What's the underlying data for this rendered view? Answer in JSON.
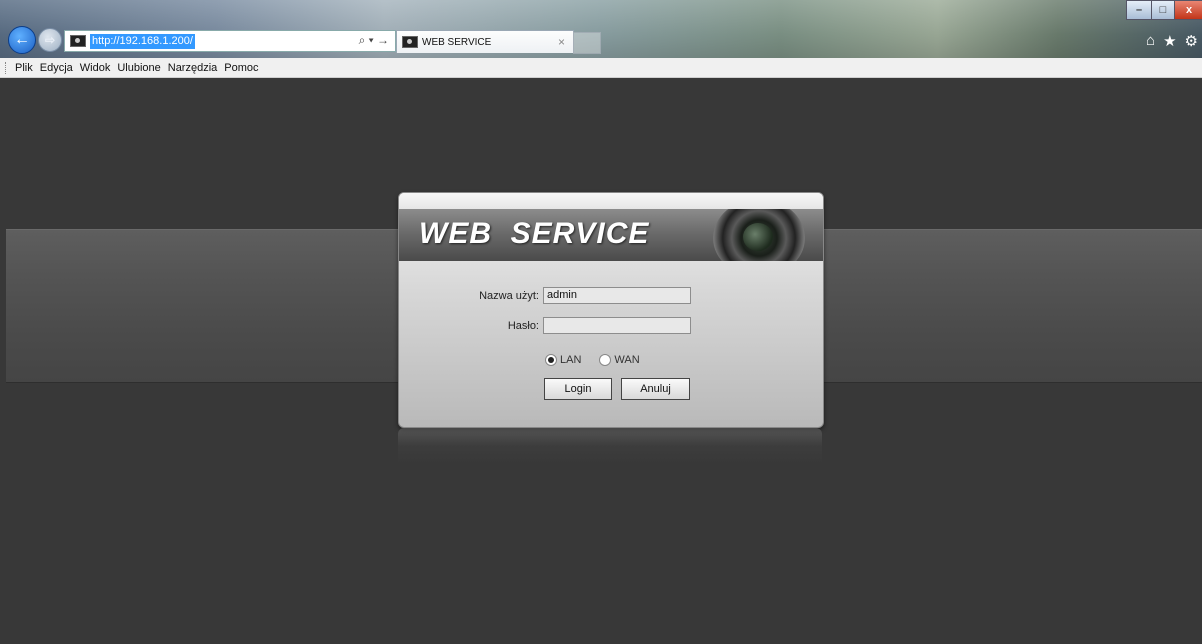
{
  "browser": {
    "url": "http://192.168.1.200/",
    "tab_title": "WEB SERVICE",
    "tab_close": "×",
    "addr_tools": "⌕ ▾ →"
  },
  "window_controls": {
    "minimize": "–",
    "maximize": "□",
    "close": "x"
  },
  "toolbar_icons": {
    "home": "⌂",
    "favorites": "★",
    "settings": "⚙"
  },
  "menubar": {
    "items": [
      "Plik",
      "Edycja",
      "Widok",
      "Ulubione",
      "Narzędzia",
      "Pomoc"
    ]
  },
  "login": {
    "banner_title": "WEB  SERVICE",
    "username_label": "Nazwa użyt:",
    "username_value": "admin",
    "password_label": "Hasło:",
    "password_value": "",
    "radio_lan": "LAN",
    "radio_wan": "WAN",
    "selected_network": "LAN",
    "login_button": "Login",
    "cancel_button": "Anuluj"
  }
}
